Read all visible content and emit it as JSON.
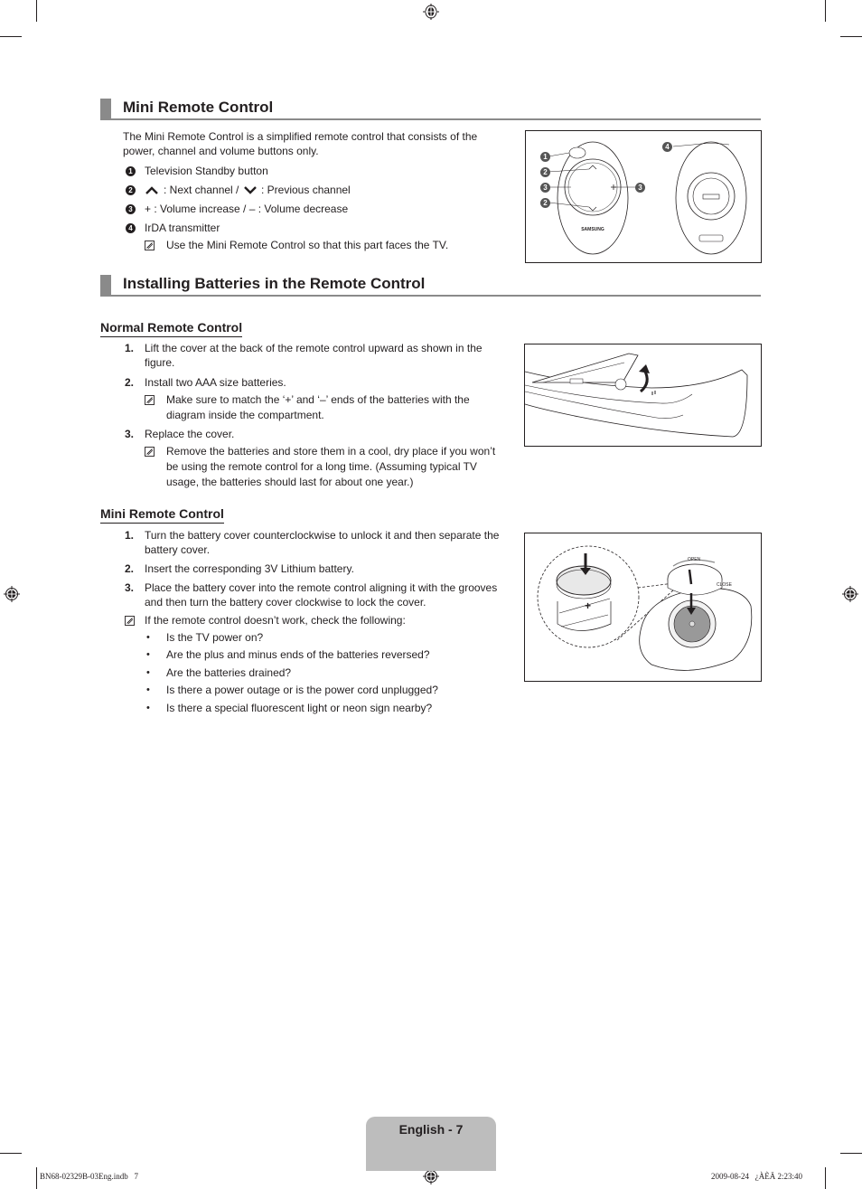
{
  "section1": {
    "title": "Mini Remote Control",
    "intro": "The Mini Remote Control is a simplified remote control that consists of the",
    "intro2": "power, channel and volume buttons only.",
    "items": [
      {
        "marker": "1",
        "text": "Television Standby button"
      },
      {
        "marker": "2",
        "text_a": ": Next channel /",
        "text_b": ": Previous channel"
      },
      {
        "marker": "3",
        "text": "+ : Volume increase / – : Volume decrease"
      },
      {
        "marker": "4",
        "text": "IrDA transmitter"
      }
    ],
    "note": "Use the Mini Remote Control so that this part faces the TV.",
    "figure": {
      "brand_label": "SAMSUNG",
      "callouts": [
        "1",
        "2",
        "3",
        "2",
        "3",
        "4"
      ]
    }
  },
  "section2": {
    "title": "Installing Batteries in the Remote Control",
    "normal": {
      "title": "Normal Remote Control",
      "steps": [
        {
          "num": "1.",
          "lines": [
            "Lift the cover at the back of the remote control upward as shown in the",
            "figure."
          ]
        },
        {
          "num": "2.",
          "lines": [
            "Install two AAA size batteries."
          ]
        },
        {
          "num": "3.",
          "lines": [
            "Replace the cover."
          ]
        }
      ],
      "notes": [
        [
          "Make sure to match the ‘+’ and ‘–’ ends of the batteries with the",
          "diagram inside the compartment."
        ],
        [
          "Remove the batteries and store them in a cool, dry place if you won’t",
          "be using the remote control for a long time. (Assuming typical TV",
          "usage, the batteries should last for about one year.)"
        ]
      ]
    },
    "mini": {
      "title": "Mini Remote Control",
      "steps": [
        {
          "num": "1.",
          "lines": [
            "Turn the battery cover counterclockwise to unlock it and then separate the",
            "battery cover."
          ]
        },
        {
          "num": "2.",
          "lines": [
            "Insert the corresponding 3V Lithium battery."
          ]
        },
        {
          "num": "3.",
          "lines": [
            "Place the battery cover into the remote control aligning it with the grooves",
            "and then turn the battery cover clockwise to lock the cover."
          ]
        }
      ],
      "note": "If the remote control doesn’t work, check the following:",
      "checks": [
        "Is the TV power on?",
        "Are the plus and minus ends of the batteries reversed?",
        "Are the batteries drained?",
        "Is there a power outage or is the power cord unplugged?",
        "Is there a special fluorescent light or neon sign nearby?"
      ],
      "figure": {
        "open_label": "OPEN",
        "close_label": "CLOSE"
      }
    }
  },
  "footer": {
    "page_label": "English - 7",
    "file_name": "BN68-02329B-03Eng.indb   7",
    "timestamp": "2009-08-24   ¿ÀÈÄ 2:23:40"
  },
  "colors": {
    "heading_bar": "#8a8a8a",
    "page_tab": "#bdbdbd",
    "text": "#231f20"
  }
}
